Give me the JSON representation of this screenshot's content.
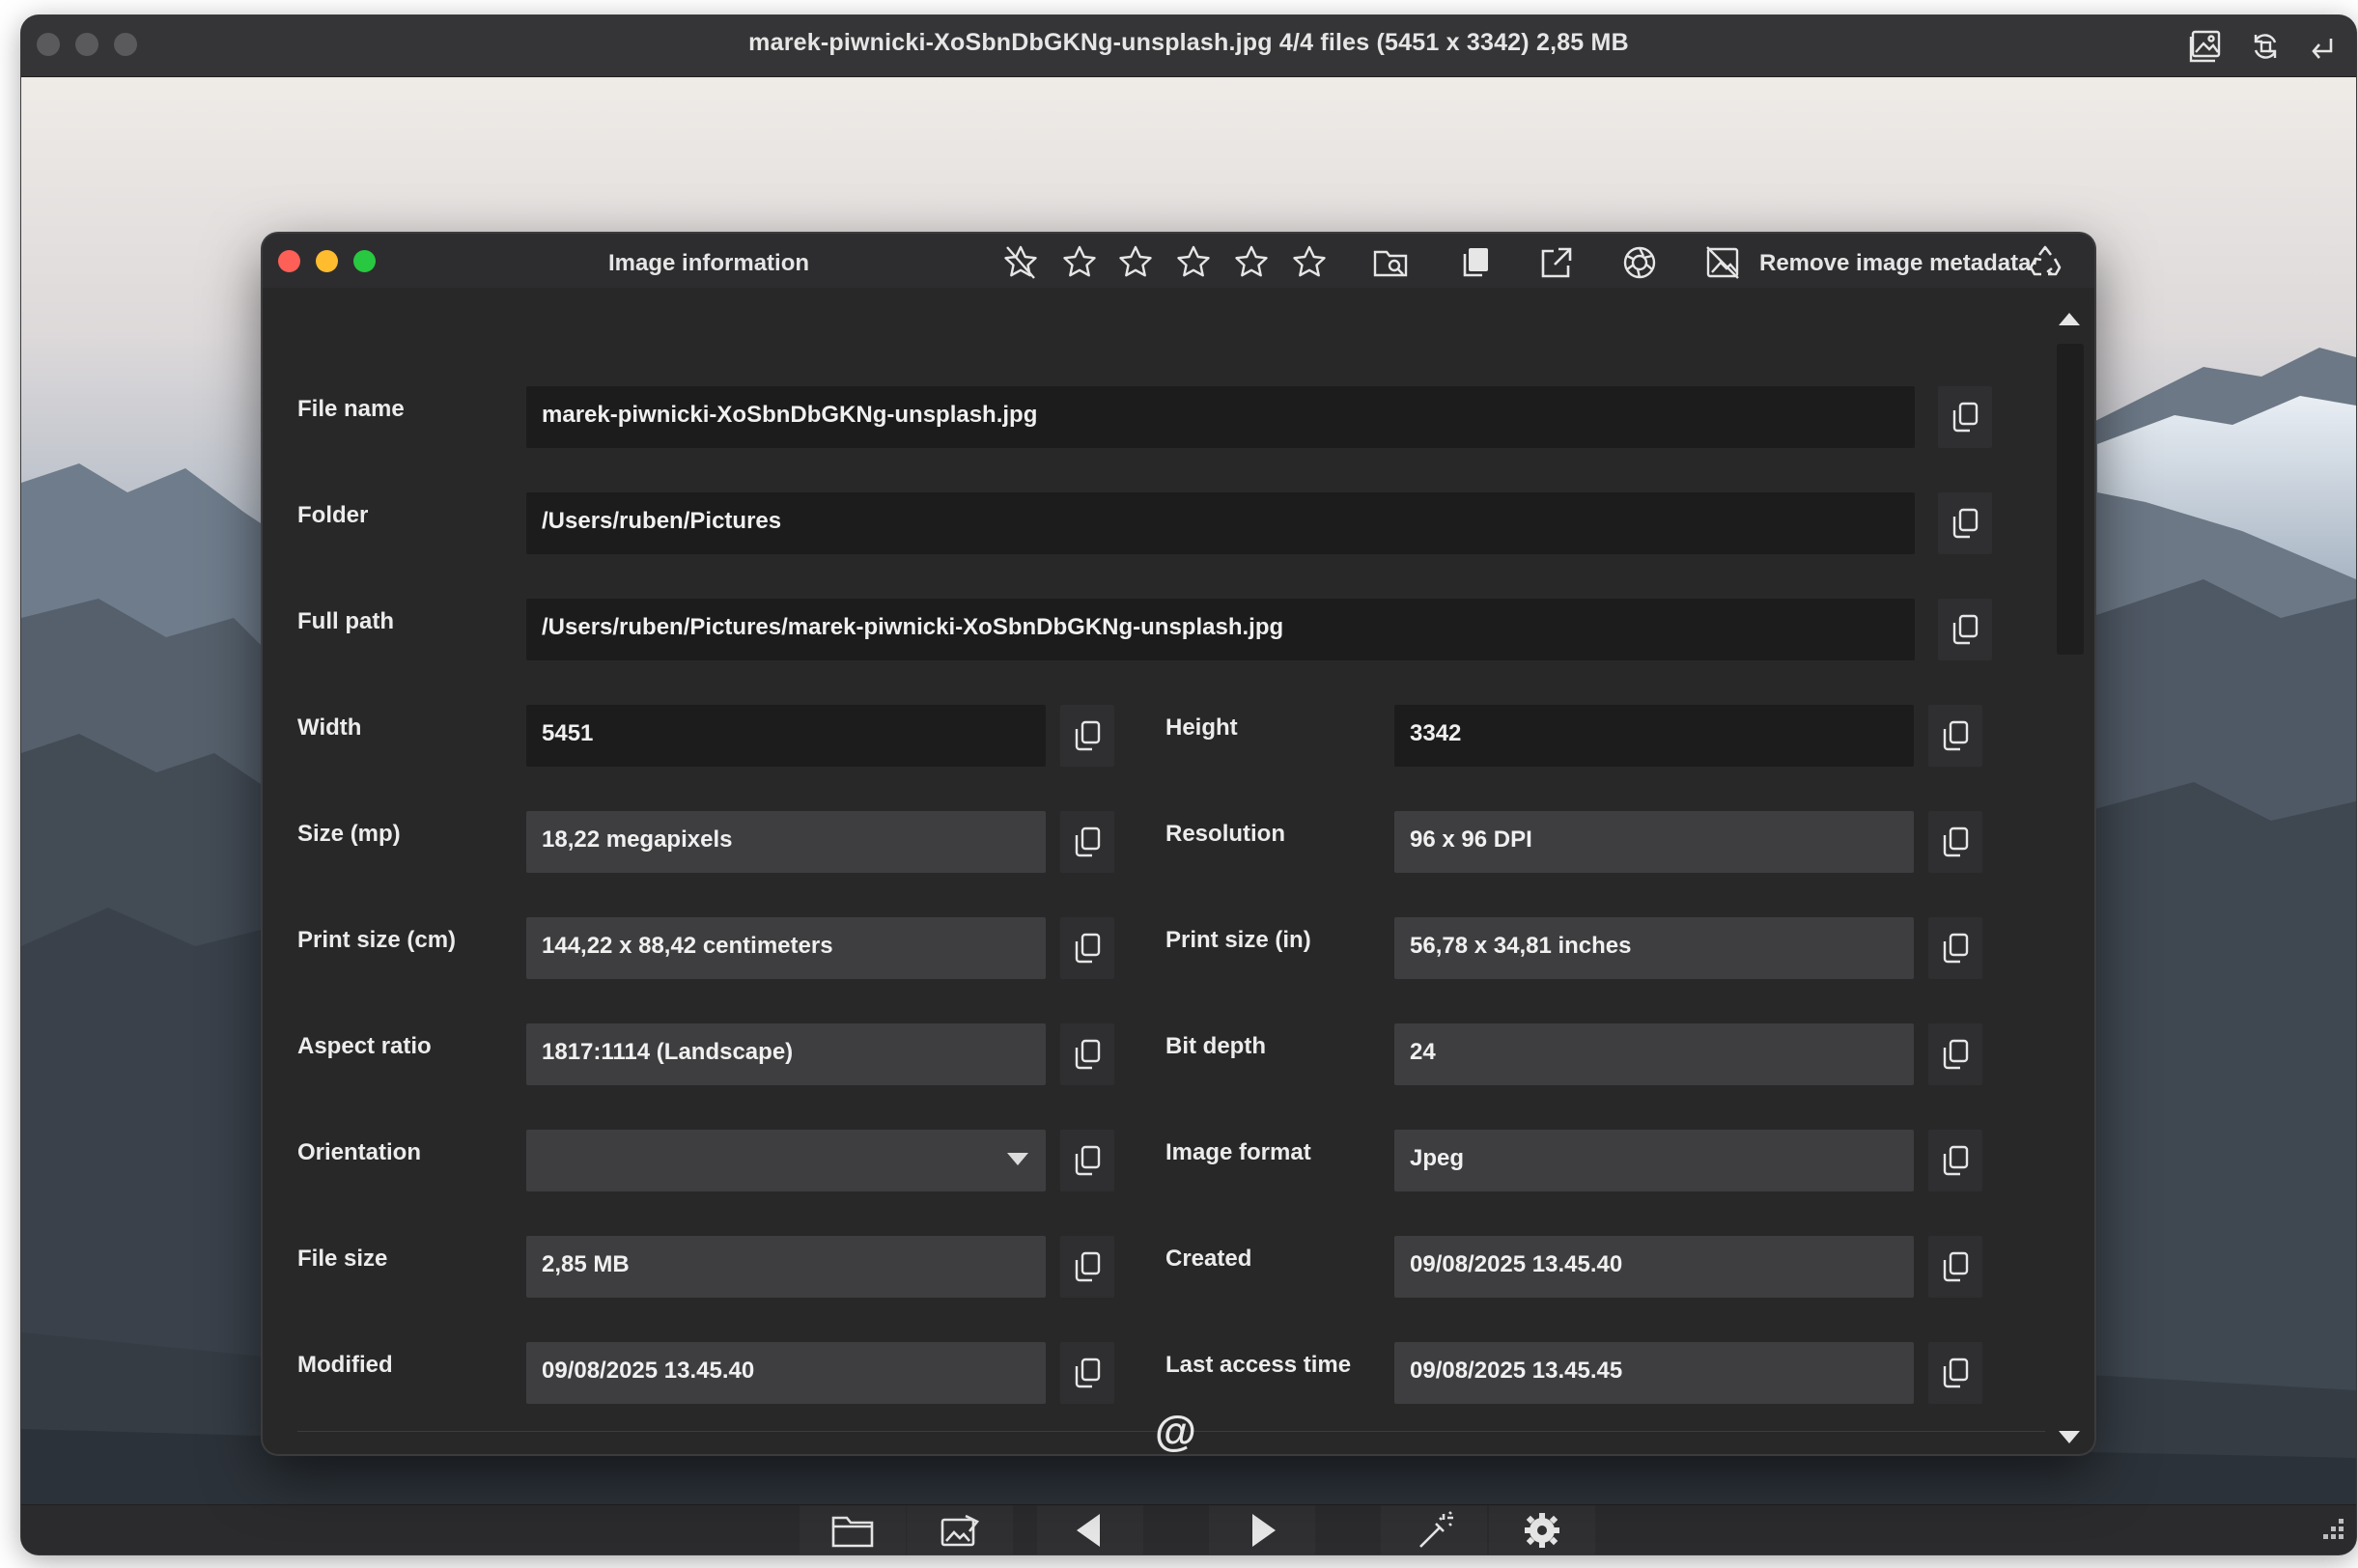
{
  "viewer": {
    "title": "marek-piwnicki-XoSbnDbGKNg-unsplash.jpg 4/4 files (5451 x 3342) 2,85 MB"
  },
  "dialog": {
    "title": "Image information",
    "remove_metadata_label": "Remove image metadata",
    "rating_stars": 5,
    "footer_symbol": "@"
  },
  "info": {
    "file_name": {
      "label": "File name",
      "value": "marek-piwnicki-XoSbnDbGKNg-unsplash.jpg"
    },
    "folder": {
      "label": "Folder",
      "value": "/Users/ruben/Pictures"
    },
    "full_path": {
      "label": "Full path",
      "value": "/Users/ruben/Pictures/marek-piwnicki-XoSbnDbGKNg-unsplash.jpg"
    },
    "width": {
      "label": "Width",
      "value": "5451"
    },
    "height": {
      "label": "Height",
      "value": "3342"
    },
    "size_mp": {
      "label": "Size (mp)",
      "value": "18,22 megapixels"
    },
    "resolution": {
      "label": "Resolution",
      "value": "96 x 96 DPI"
    },
    "print_cm": {
      "label": "Print size (cm)",
      "value": "144,22 x 88,42 centimeters"
    },
    "print_in": {
      "label": "Print size (in)",
      "value": "56,78 x 34,81 inches"
    },
    "aspect": {
      "label": "Aspect ratio",
      "value": "1817:1114 (Landscape)"
    },
    "bit_depth": {
      "label": "Bit depth",
      "value": "24"
    },
    "orientation": {
      "label": "Orientation",
      "value": ""
    },
    "format": {
      "label": "Image format",
      "value": "Jpeg"
    },
    "file_size": {
      "label": "File size",
      "value": "2,85 MB"
    },
    "created": {
      "label": "Created",
      "value": "09/08/2025 13.45.40"
    },
    "modified": {
      "label": "Modified",
      "value": "09/08/2025 13.45.40"
    },
    "last_access": {
      "label": "Last access time",
      "value": "09/08/2025 13.45.45"
    }
  },
  "icons": {
    "dialog_toolbar": [
      "clear-rating-icon",
      "star-icon",
      "star-icon",
      "star-icon",
      "star-icon",
      "star-icon",
      "show-in-folder-icon",
      "copy-file-icon",
      "open-with-icon",
      "aperture-icon",
      "remove-metadata-icon",
      "recycle-icon"
    ],
    "viewer_toolbar": [
      "gallery-icon",
      "rotate-icon",
      "return-icon"
    ],
    "bottom_toolbar": [
      "folder-open-icon",
      "edit-image-icon",
      "previous-icon",
      "next-icon",
      "magic-wand-icon",
      "settings-gear-icon"
    ]
  }
}
